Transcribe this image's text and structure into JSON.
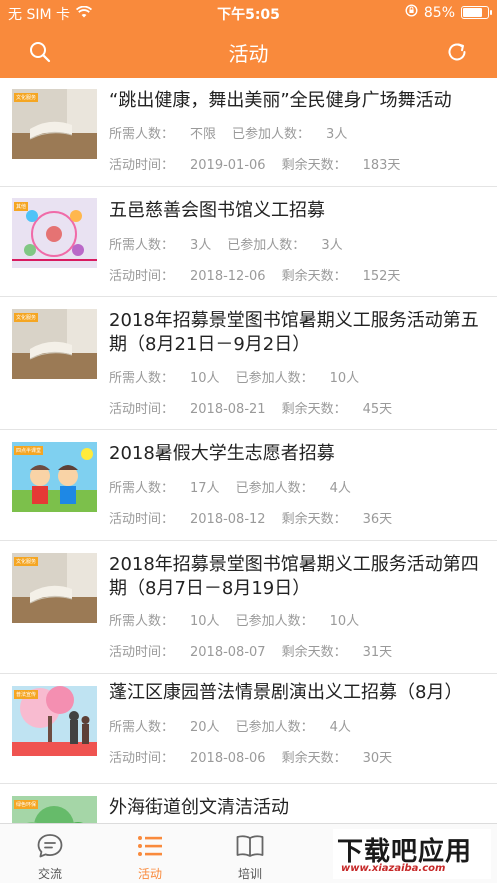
{
  "status_bar": {
    "carrier": "无 SIM 卡",
    "time": "下午5:05",
    "battery_text": "85%",
    "battery_level": 0.85
  },
  "nav": {
    "title": "活动",
    "left_icon": "search-icon",
    "right_icon": "refresh-icon"
  },
  "colors": {
    "accent": "#f98a3c",
    "title_text": "#222222",
    "meta_text": "#9a9a9a"
  },
  "labels": {
    "required": "所需人数：",
    "joined": "已参加人数：",
    "time": "活动时间：",
    "remaining": "剩余天数："
  },
  "activities": [
    {
      "title": "“跳出健康，舞出美丽”全民健身广场舞活动",
      "required": "不限",
      "joined": "3人",
      "date": "2019-01-06",
      "remaining": "183天",
      "tag": "文化服务"
    },
    {
      "title": "五邑慈善会图书馆义工招募",
      "required": "3人",
      "joined": "3人",
      "date": "2018-12-06",
      "remaining": "152天",
      "tag": "其他"
    },
    {
      "title": "2018年招募景堂图书馆暑期义工服务活动第五期（8月21日－9月2日）",
      "required": "10人",
      "joined": "10人",
      "date": "2018-08-21",
      "remaining": "45天",
      "tag": "文化服务"
    },
    {
      "title": "2018暑假大学生志愿者招募",
      "required": "17人",
      "joined": "4人",
      "date": "2018-08-12",
      "remaining": "36天",
      "tag": "四点半课堂"
    },
    {
      "title": "2018年招募景堂图书馆暑期义工服务活动第四期（8月7日－8月19日）",
      "required": "10人",
      "joined": "10人",
      "date": "2018-08-07",
      "remaining": "31天",
      "tag": "文化服务"
    },
    {
      "title": "蓬江区康园普法情景剧演出义工招募（8月）",
      "required": "20人",
      "joined": "4人",
      "date": "2018-08-06",
      "remaining": "30天",
      "tag": "普法宣传"
    },
    {
      "title": "外海街道创文清洁活动",
      "tag": "绿色环保"
    }
  ],
  "tabs": [
    {
      "label": "交流",
      "icon": "chat-bubble-icon",
      "active": false
    },
    {
      "label": "活动",
      "icon": "list-icon",
      "active": true
    },
    {
      "label": "培训",
      "icon": "book-icon",
      "active": false
    }
  ],
  "watermark": {
    "main": "下载吧应用",
    "url": "www.xiazaiba.com"
  }
}
